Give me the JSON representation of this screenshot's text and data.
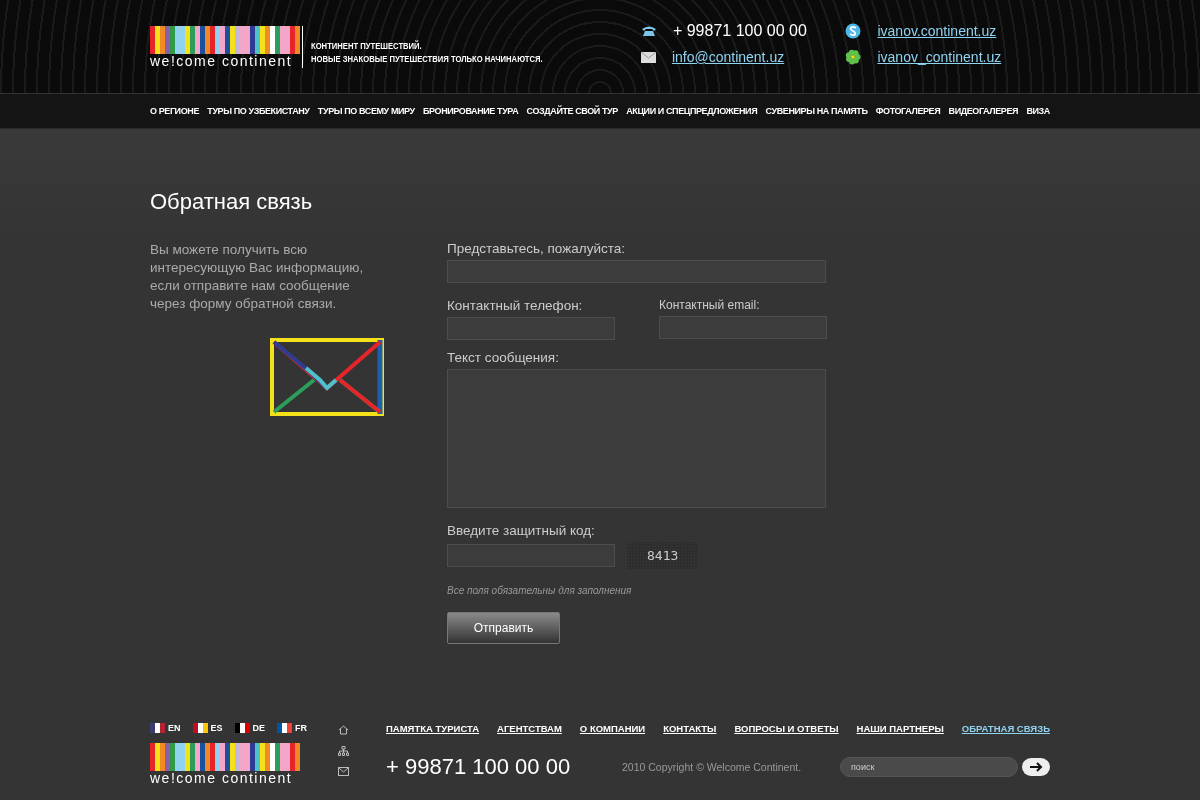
{
  "header": {
    "logo_text": "we!come continent",
    "tagline": [
      "КОНТИНЕНТ ПУТЕШЕСТВИЙ.",
      "НОВЫЕ ЗНАКОВЫЕ ПУТЕШЕСТВИЯ ТОЛЬКО НАЧИНАЮТСЯ."
    ],
    "phone": "+ 99871 100 00 00",
    "email": "info@continent.uz",
    "skype": "ivanov.continent.uz",
    "icq": "ivanov_continent.uz"
  },
  "nav": [
    "О РЕГИОНЕ",
    "ТУРЫ ПО УЗБЕКИСТАНУ",
    "ТУРЫ ПО ВСЕМУ МИРУ",
    "БРОНИРОВАНИЕ ТУРА",
    "СОЗДАЙТЕ СВОЙ ТУР",
    "АКЦИИ И СПЕЦПРЕДЛОЖЕНИЯ",
    "СУВЕНИРЫ НА ПАМЯТЬ",
    "ФОТОГАЛЕРЕЯ",
    "ВИДЕОГАЛЕРЕЯ",
    "ВИЗА"
  ],
  "page_title": "Обратная связь",
  "intro": "Вы можете получить всю интересующую Вас информацию, если отправите нам сообщение через форму обратной связи.",
  "form": {
    "name_label": "Представьтесь, пожалуйста:",
    "phone_label": "Контактный телефон:",
    "email_label": "Контактный email:",
    "message_label": "Текст сообщения:",
    "captcha_label": "Введите защитный код:",
    "captcha_code": "8413",
    "note": "Все поля обязательны для заполнения",
    "submit": "Отправить"
  },
  "footer": {
    "languages": [
      "EN",
      "ES",
      "DE",
      "FR"
    ],
    "links": [
      {
        "label": "ПАМЯТКА ТУРИСТА",
        "selected": false
      },
      {
        "label": "АГЕНТСТВАМ",
        "selected": false
      },
      {
        "label": "О КОМПАНИИ",
        "selected": false
      },
      {
        "label": "КОНТАКТЫ",
        "selected": false
      },
      {
        "label": "ВОПРОСЫ И ОТВЕТЫ",
        "selected": false
      },
      {
        "label": "НАШИ ПАРТНЕРЫ",
        "selected": false
      },
      {
        "label": "ОБРАТНАЯ СВЯЗЬ",
        "selected": true
      }
    ],
    "logo_text": "we!come continent",
    "phone": "+ 99871 100 00 00",
    "copyright": "2010 Copyright © Welcome Continent.",
    "search_placeholder": "поиск"
  }
}
